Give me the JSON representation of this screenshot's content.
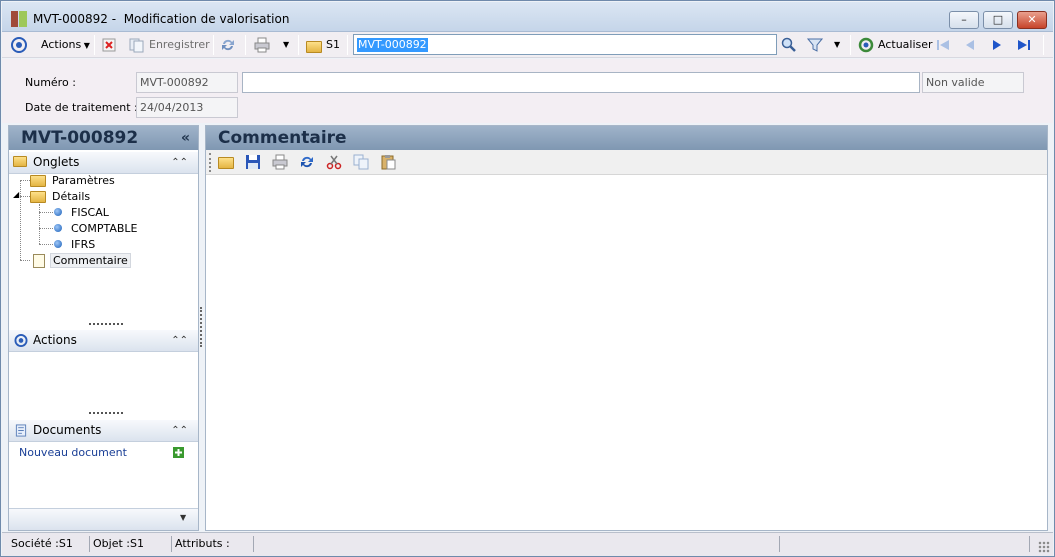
{
  "window": {
    "title": "MVT-000892 -  Modification de valorisation",
    "buttons": {
      "minimize": "–",
      "maximize": "□",
      "close": "✕"
    }
  },
  "toolbar": {
    "actions_label": "Actions",
    "save_label": "Enregistrer",
    "company_label": "S1",
    "search_value": "MVT-000892",
    "refresh_label": "Actualiser"
  },
  "header": {
    "numero_label": "Numéro :",
    "numero_value": "MVT-000892",
    "description_value": "",
    "status_value": "Non valide",
    "date_label": "Date de traitement :",
    "date_value": "24/04/2013"
  },
  "left_panel": {
    "title": "MVT-000892",
    "collapse_glyph": "«",
    "tabs_section": {
      "label": "Onglets",
      "items": [
        {
          "label": "Paramètres"
        },
        {
          "label": "Détails"
        },
        {
          "label": "FISCAL"
        },
        {
          "label": "COMPTABLE"
        },
        {
          "label": "IFRS"
        },
        {
          "label": "Commentaire"
        }
      ]
    },
    "actions_section": {
      "label": "Actions"
    },
    "documents_section": {
      "label": "Documents",
      "new_document": "Nouveau document"
    }
  },
  "main_panel": {
    "title": "Commentaire"
  },
  "status_bar": {
    "societe": "Société :S1",
    "objet": "Objet :S1",
    "attributs": "Attributs :"
  }
}
